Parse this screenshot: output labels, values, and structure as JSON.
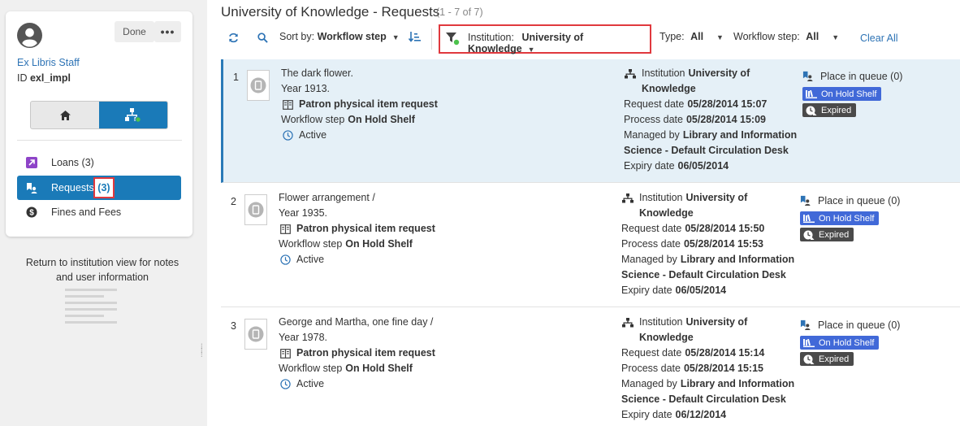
{
  "user": {
    "name": "Ex Libris Staff",
    "id_label": "ID",
    "id_value": "exl_impl",
    "done_label": "Done",
    "more_label": "•••"
  },
  "nav": {
    "items": [
      {
        "label": "Loans",
        "count": "(3)",
        "icon": "arrow-up-right-icon"
      },
      {
        "label": "Requests",
        "count": "(3)",
        "icon": "requests-icon"
      },
      {
        "label": "Fines and Fees",
        "count": "",
        "icon": "dollar-icon"
      }
    ]
  },
  "left": {
    "return_text": "Return to institution view for notes and user information"
  },
  "header": {
    "title": "University of Knowledge - Requests",
    "count": "(1 - 7 of 7)"
  },
  "toolbar": {
    "sort_label": "Sort by:",
    "sort_value": "Workflow step",
    "institution_label": "Institution:",
    "institution_value": "University of Knowledge",
    "type_label": "Type:",
    "type_value": "All",
    "workflow_label": "Workflow step:",
    "workflow_value": "All",
    "clear_all": "Clear All"
  },
  "labels": {
    "institution": "Institution",
    "request_date": "Request date",
    "process_date": "Process date",
    "managed_by": "Managed by",
    "expiry_date": "Expiry date",
    "workflow_step": "Workflow step",
    "place_in_queue": "Place in queue (0)",
    "on_hold_shelf": "On Hold Shelf",
    "expired": "Expired",
    "request_type": "Patron physical item request",
    "active": "Active"
  },
  "requests": [
    {
      "num": "1",
      "title": "The dark flower.",
      "year": "Year 1913.",
      "workflow_value": "On Hold Shelf",
      "inst_line1": "University of",
      "inst_line2": "Knowledge",
      "request_date": "05/28/2014 15:07",
      "process_date": "05/28/2014 15:09",
      "managed_line1": "Library and Information",
      "managed_line2": "Science - Default Circulation Desk",
      "expiry_date": "06/05/2014"
    },
    {
      "num": "2",
      "title": "Flower arrangement /",
      "year": "Year 1935.",
      "workflow_value": "On Hold Shelf",
      "inst_line1": "University of",
      "inst_line2": "Knowledge",
      "request_date": "05/28/2014 15:50",
      "process_date": "05/28/2014 15:53",
      "managed_line1": "Library and Information",
      "managed_line2": "Science - Default Circulation Desk",
      "expiry_date": "06/05/2014"
    },
    {
      "num": "3",
      "title": "George and Martha, one fine day /",
      "year": "Year 1978.",
      "workflow_value": "On Hold Shelf",
      "inst_line1": "University of",
      "inst_line2": "Knowledge",
      "request_date": "05/28/2014 15:14",
      "process_date": "05/28/2014 15:15",
      "managed_line1": "Library and Information",
      "managed_line2": "Science - Default Circulation Desk",
      "expiry_date": "06/12/2014"
    }
  ],
  "colors": {
    "accent": "#1a7ab8",
    "link": "#2d73b5",
    "highlight_box": "#e0393e",
    "badge_blue": "#4169d8",
    "badge_dark": "#4a4a4a",
    "selected_row": "#e5f0f7"
  }
}
